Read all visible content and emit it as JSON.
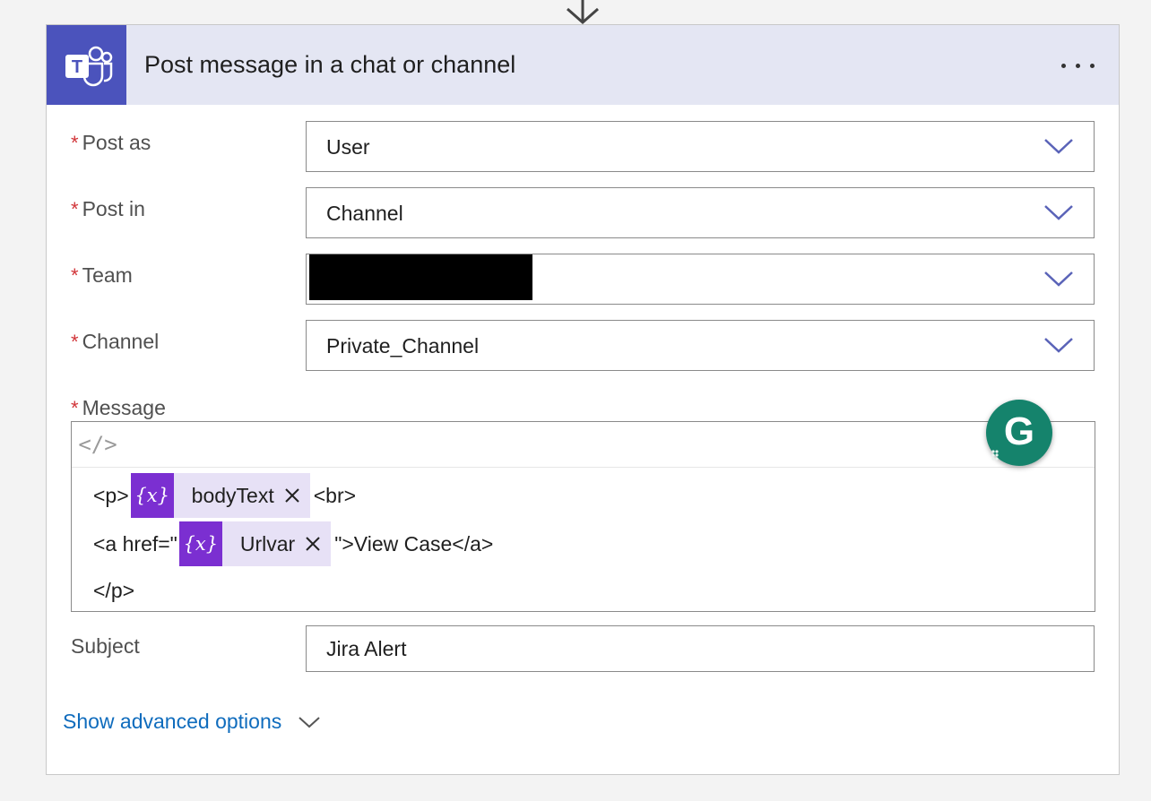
{
  "card": {
    "title": "Post message in a chat or channel",
    "header_color": "#e4e6f3",
    "app_icon": "teams-icon",
    "app_icon_color": "#4b53bc",
    "icon_letter": "T"
  },
  "fields": {
    "post_as": {
      "label": "Post as",
      "value": "User"
    },
    "post_in": {
      "label": "Post in",
      "value": "Channel"
    },
    "team": {
      "label": "Team",
      "value": ""
    },
    "channel": {
      "label": "Channel",
      "value": "Private_Channel"
    },
    "message": {
      "label": "Message",
      "code_toggle": "</>",
      "line1_prefix": "<p>",
      "line1_suffix": "<br>",
      "line2_prefix": "<a href=\"",
      "line2_suffix": "\">View Case</a>",
      "line3": "</p>",
      "tokens": [
        {
          "label": "bodyText",
          "icon": "{x}"
        },
        {
          "label": "Urlvar",
          "icon": "{x}"
        }
      ]
    },
    "subject": {
      "label": "Subject",
      "value": "Jira Alert"
    }
  },
  "advanced": {
    "label": "Show advanced options"
  },
  "required_marker": "*",
  "grammarly": {
    "letter": "G",
    "color": "#15836c"
  }
}
